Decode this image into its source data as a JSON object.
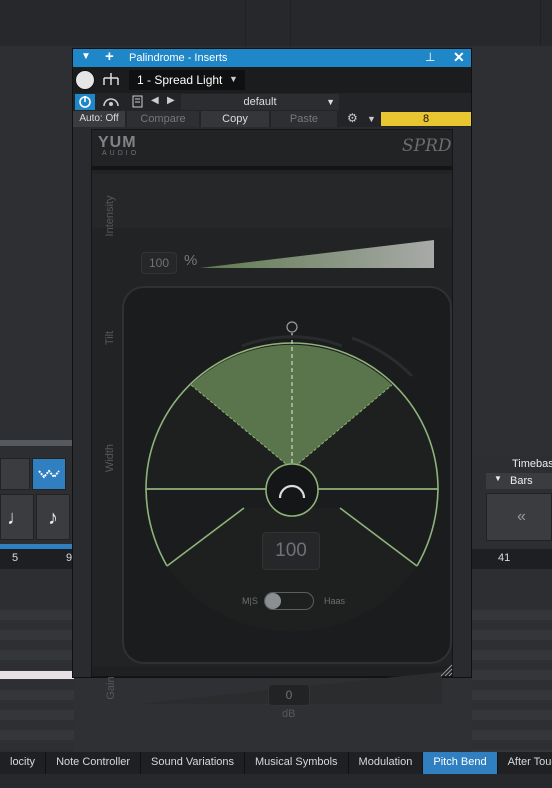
{
  "window": {
    "title": "Palindrome - Inserts",
    "insert_slot": "1 - Spread Light",
    "preset_name": "default",
    "auto_label": "Auto: Off",
    "compare_label": "Compare",
    "copy_label": "Copy",
    "paste_label": "Paste",
    "slot_number": "8"
  },
  "plugin": {
    "brand_top": "YUM",
    "brand_bottom": "AUDIO",
    "product_logo": "SPRD",
    "intensity_label": "Intensity",
    "intensity_value": "100",
    "intensity_unit": "%",
    "tilt_label": "Tilt",
    "width_label": "Width",
    "width_value": "100",
    "mode_left": "M|S",
    "mode_right": "Haas",
    "gain_label": "Gain",
    "gain_value": "0",
    "gain_unit": "dB",
    "accent_color": "#8fb37a"
  },
  "daw": {
    "timebase_label": "Timebas",
    "timebase_value": "Bars",
    "ruler_left": [
      "5",
      "9"
    ],
    "ruler_right": "41",
    "tabs": [
      {
        "label": "locity"
      },
      {
        "label": "Note Controller"
      },
      {
        "label": "Sound Variations"
      },
      {
        "label": "Musical Symbols"
      },
      {
        "label": "Modulation"
      },
      {
        "label": "Pitch Bend"
      },
      {
        "label": "After Touch"
      }
    ]
  }
}
